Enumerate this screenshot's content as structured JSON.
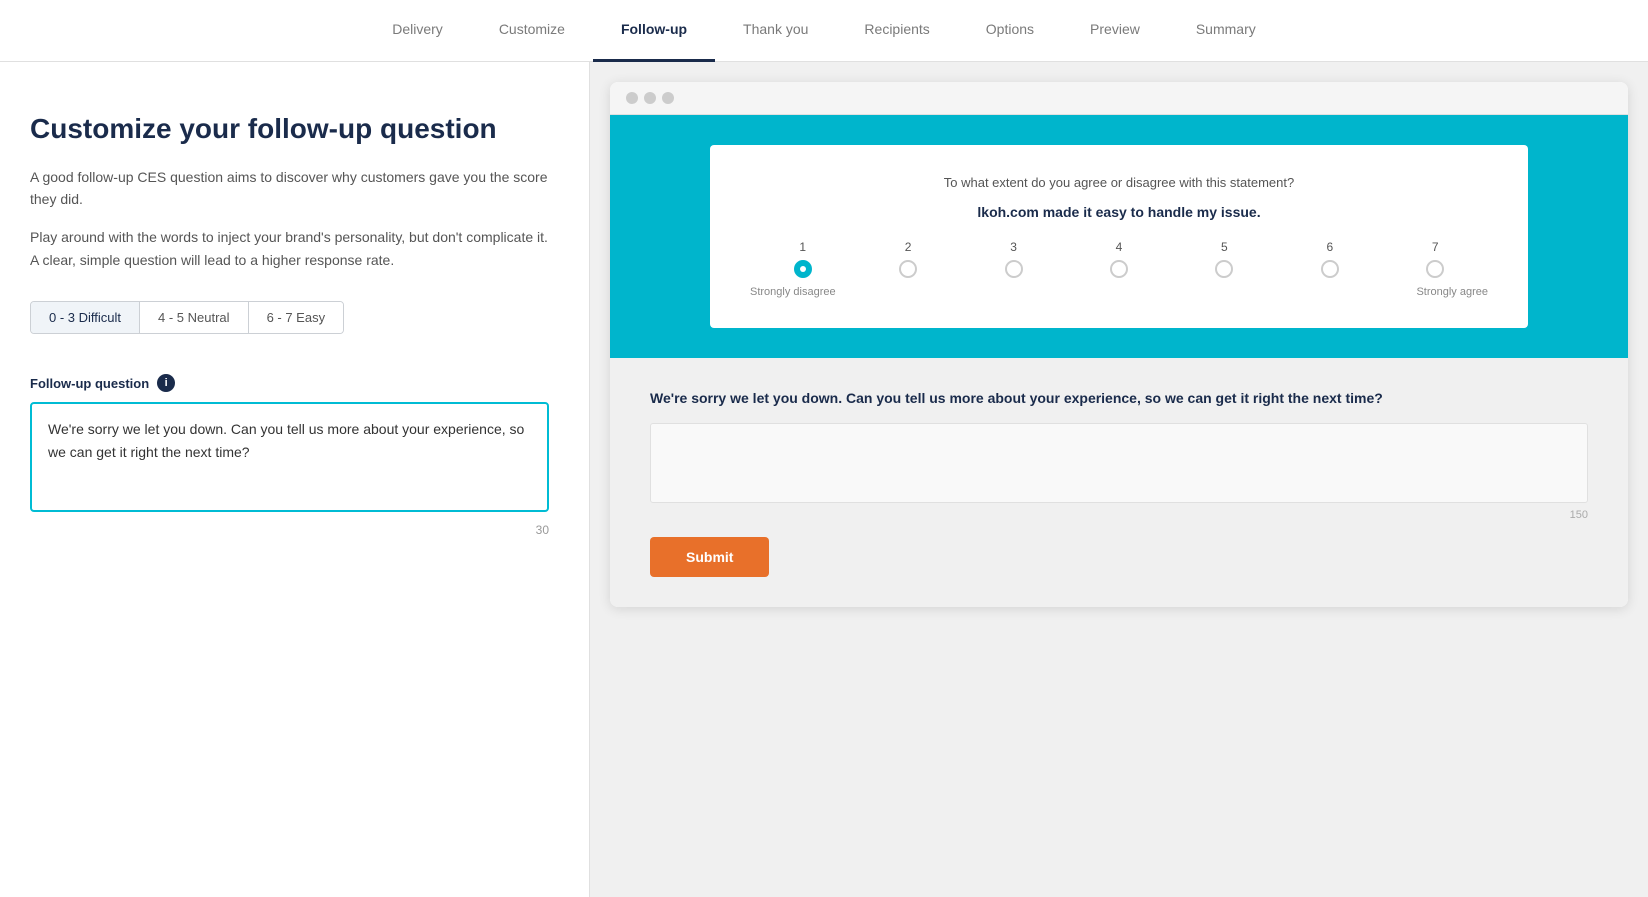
{
  "nav": {
    "items": [
      {
        "id": "delivery",
        "label": "Delivery",
        "active": false
      },
      {
        "id": "customize",
        "label": "Customize",
        "active": false
      },
      {
        "id": "followup",
        "label": "Follow-up",
        "active": true
      },
      {
        "id": "thankyou",
        "label": "Thank you",
        "active": false
      },
      {
        "id": "recipients",
        "label": "Recipients",
        "active": false
      },
      {
        "id": "options",
        "label": "Options",
        "active": false
      },
      {
        "id": "preview",
        "label": "Preview",
        "active": false
      },
      {
        "id": "summary",
        "label": "Summary",
        "active": false
      }
    ]
  },
  "left": {
    "heading": "Customize your follow-up question",
    "desc1": "A good follow-up CES question aims to discover why customers gave you the score they did.",
    "desc2": "Play around with the words to inject your brand's personality, but don't complicate it. A clear, simple question will lead to a higher response rate.",
    "score_buttons": [
      {
        "id": "difficult",
        "label": "0 - 3 Difficult",
        "active": true
      },
      {
        "id": "neutral",
        "label": "4 - 5 Neutral",
        "active": false
      },
      {
        "id": "easy",
        "label": "6 - 7 Easy",
        "active": false
      }
    ],
    "followup_label": "Follow-up question",
    "followup_text": "We're sorry we let you down. Can you tell us more about your experience, so we can get it right the next time?",
    "char_count": "30"
  },
  "preview": {
    "survey_question": "To what extent do you agree or disagree with this statement?",
    "statement": "lkoh.com made it easy to handle my issue.",
    "rating_numbers": [
      "1",
      "2",
      "3",
      "4",
      "5",
      "6",
      "7"
    ],
    "selected_rating": 1,
    "label_left": "Strongly disagree",
    "label_right": "Strongly agree",
    "followup_q": "We're sorry we let you down. Can you tell us more about your experience, so we can get it right the next time?",
    "textarea_char": "150",
    "submit_label": "Submit"
  }
}
